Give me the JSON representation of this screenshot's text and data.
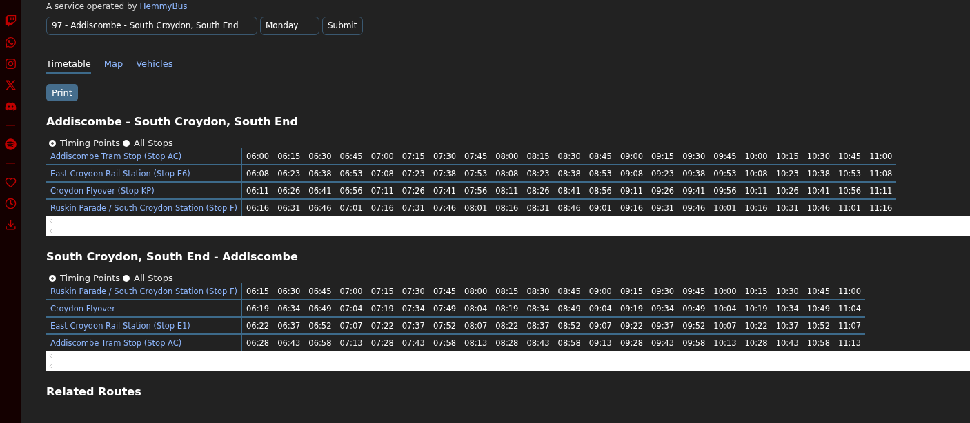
{
  "operator_line": {
    "text": "A service operated by",
    "link": "HemmyBus"
  },
  "route_select": {
    "value": "97 - Addiscombe - South Croydon, South End"
  },
  "day_select": {
    "value": "Monday"
  },
  "submit": "Submit",
  "tabs": [
    {
      "label": "Timetable",
      "selected": true
    },
    {
      "label": "Map",
      "selected": false
    },
    {
      "label": "Vehicles",
      "selected": false
    }
  ],
  "print": "Print",
  "timetables": [
    {
      "title": "Addiscombe - South Croydon, South End",
      "options": [
        {
          "label": "Timing Points",
          "selected": true
        },
        {
          "label": "All Stops",
          "selected": false
        }
      ],
      "rows": [
        {
          "stop": "Addiscombe Tram Stop (Stop AC)",
          "times": [
            "06:00",
            "06:15",
            "06:30",
            "06:45",
            "07:00",
            "07:15",
            "07:30",
            "07:45",
            "08:00",
            "08:15",
            "08:30",
            "08:45",
            "09:00",
            "09:15",
            "09:30",
            "09:45",
            "10:00",
            "10:15",
            "10:30",
            "10:45",
            "11:00"
          ]
        },
        {
          "stop": "East Croydon Rail Station (Stop E6)",
          "times": [
            "06:08",
            "06:23",
            "06:38",
            "06:53",
            "07:08",
            "07:23",
            "07:38",
            "07:53",
            "08:08",
            "08:23",
            "08:38",
            "08:53",
            "09:08",
            "09:23",
            "09:38",
            "09:53",
            "10:08",
            "10:23",
            "10:38",
            "10:53",
            "11:08"
          ]
        },
        {
          "stop": "Croydon Flyover (Stop KP)",
          "times": [
            "06:11",
            "06:26",
            "06:41",
            "06:56",
            "07:11",
            "07:26",
            "07:41",
            "07:56",
            "08:11",
            "08:26",
            "08:41",
            "08:56",
            "09:11",
            "09:26",
            "09:41",
            "09:56",
            "10:11",
            "10:26",
            "10:41",
            "10:56",
            "11:11"
          ]
        },
        {
          "stop": "Ruskin Parade / South Croydon Station (Stop F)",
          "times": [
            "06:16",
            "06:31",
            "06:46",
            "07:01",
            "07:16",
            "07:31",
            "07:46",
            "08:01",
            "08:16",
            "08:31",
            "08:46",
            "09:01",
            "09:16",
            "09:31",
            "09:46",
            "10:01",
            "10:16",
            "10:31",
            "10:46",
            "11:01",
            "11:16"
          ]
        }
      ]
    },
    {
      "title": "South Croydon, South End - Addiscombe",
      "options": [
        {
          "label": "Timing Points",
          "selected": true
        },
        {
          "label": "All Stops",
          "selected": false
        }
      ],
      "rows": [
        {
          "stop": "Ruskin Parade / South Croydon Station (Stop F)",
          "times": [
            "06:15",
            "06:30",
            "06:45",
            "07:00",
            "07:15",
            "07:30",
            "07:45",
            "08:00",
            "08:15",
            "08:30",
            "08:45",
            "09:00",
            "09:15",
            "09:30",
            "09:45",
            "10:00",
            "10:15",
            "10:30",
            "10:45",
            "11:00"
          ]
        },
        {
          "stop": "Croydon Flyover",
          "times": [
            "06:19",
            "06:34",
            "06:49",
            "07:04",
            "07:19",
            "07:34",
            "07:49",
            "08:04",
            "08:19",
            "08:34",
            "08:49",
            "09:04",
            "09:19",
            "09:34",
            "09:49",
            "10:04",
            "10:19",
            "10:34",
            "10:49",
            "11:04"
          ]
        },
        {
          "stop": "East Croydon Rail Station (Stop E1)",
          "times": [
            "06:22",
            "06:37",
            "06:52",
            "07:07",
            "07:22",
            "07:37",
            "07:52",
            "08:07",
            "08:22",
            "08:37",
            "08:52",
            "09:07",
            "09:22",
            "09:37",
            "09:52",
            "10:07",
            "10:22",
            "10:37",
            "10:52",
            "11:07"
          ]
        },
        {
          "stop": "Addiscombe Tram Stop (Stop AC)",
          "times": [
            "06:28",
            "06:43",
            "06:58",
            "07:13",
            "07:28",
            "07:43",
            "07:58",
            "08:13",
            "08:28",
            "08:43",
            "08:58",
            "09:13",
            "09:28",
            "09:43",
            "09:58",
            "10:13",
            "10:28",
            "10:43",
            "10:58",
            "11:13"
          ]
        }
      ]
    }
  ],
  "related_title": "Related Routes"
}
